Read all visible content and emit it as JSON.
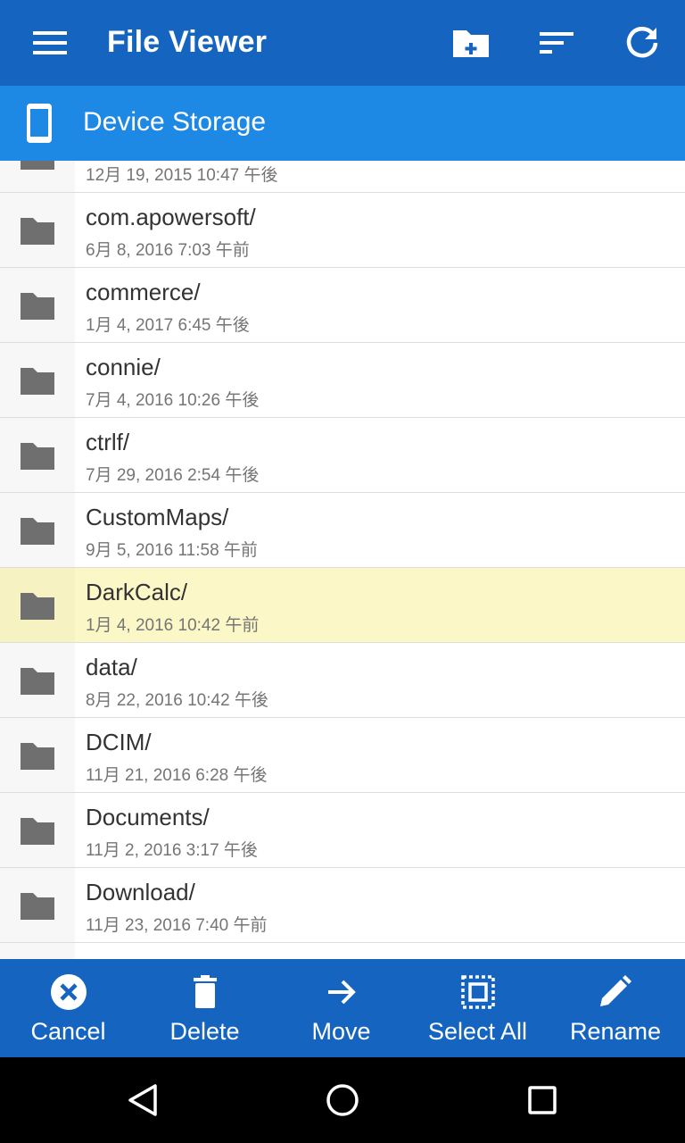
{
  "app": {
    "title": "File Viewer",
    "location": "Device Storage",
    "accent_color": "#1565c0",
    "secondary_color": "#1e88e5",
    "selected_row_color": "#fcf7c6"
  },
  "toolbar": {
    "icons": [
      "menu-icon",
      "new-folder-icon",
      "sort-icon",
      "refresh-icon"
    ]
  },
  "files": [
    {
      "name": "",
      "date": "12月 19, 2015 10:47 午後",
      "selected": false
    },
    {
      "name": "com.apowersoft/",
      "date": "6月 8, 2016 7:03 午前",
      "selected": false
    },
    {
      "name": "commerce/",
      "date": "1月 4, 2017 6:45 午後",
      "selected": false
    },
    {
      "name": "connie/",
      "date": "7月 4, 2016 10:26 午後",
      "selected": false
    },
    {
      "name": "ctrlf/",
      "date": "7月 29, 2016 2:54 午後",
      "selected": false
    },
    {
      "name": "CustomMaps/",
      "date": "9月 5, 2016 11:58 午前",
      "selected": false
    },
    {
      "name": "DarkCalc/",
      "date": "1月 4, 2016 10:42 午前",
      "selected": true
    },
    {
      "name": "data/",
      "date": "8月 22, 2016 10:42 午後",
      "selected": false
    },
    {
      "name": "DCIM/",
      "date": "11月 21, 2016 6:28 午後",
      "selected": false
    },
    {
      "name": "Documents/",
      "date": "11月 2, 2016 3:17 午後",
      "selected": false
    },
    {
      "name": "Download/",
      "date": "11月 23, 2016 7:40 午前",
      "selected": false
    },
    {
      "name": "",
      "date": "",
      "selected": false
    }
  ],
  "actions": {
    "cancel": "Cancel",
    "delete": "Delete",
    "move": "Move",
    "select_all": "Select All",
    "rename": "Rename"
  },
  "nav": {
    "icons": [
      "back-icon",
      "home-icon",
      "recents-icon"
    ]
  }
}
